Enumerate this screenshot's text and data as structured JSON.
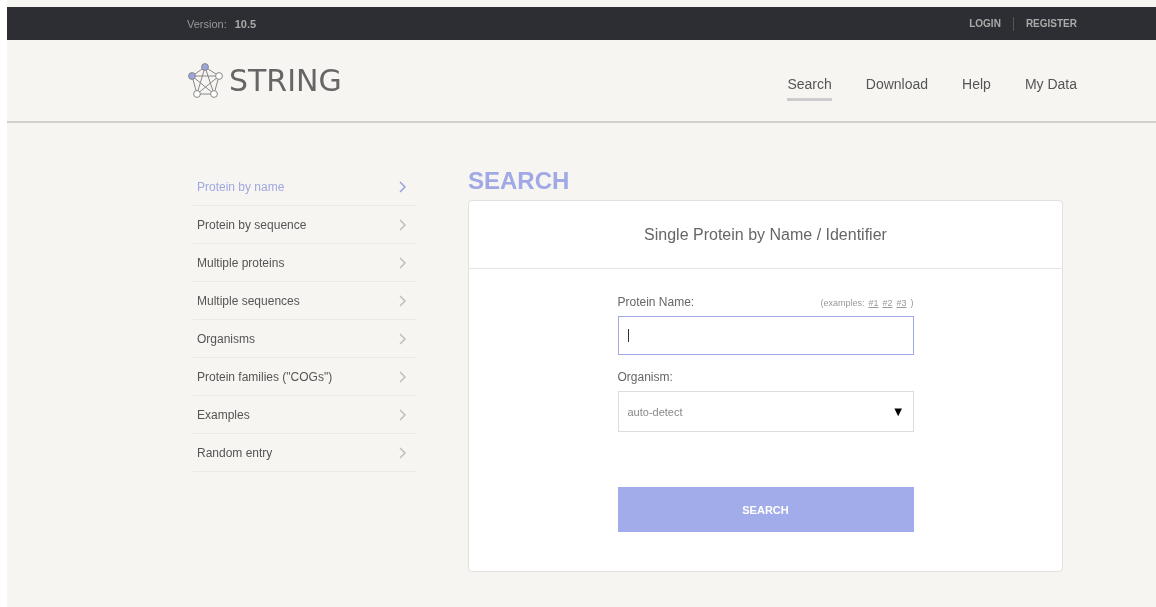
{
  "top_bar": {
    "version_label": "Version:",
    "version": "10.5",
    "links": [
      "LOGIN",
      "REGISTER"
    ]
  },
  "header": {
    "logo_text": "STRING",
    "nav": [
      {
        "label": "Search",
        "selected": true
      },
      {
        "label": "Download",
        "selected": false
      },
      {
        "label": "Help",
        "selected": false
      },
      {
        "label": "My Data",
        "selected": false
      }
    ]
  },
  "sidebar": {
    "items": [
      {
        "label": "Protein by name",
        "selected": true
      },
      {
        "label": "Protein by sequence",
        "selected": false
      },
      {
        "label": "Multiple proteins",
        "selected": false
      },
      {
        "label": "Multiple sequences",
        "selected": false
      },
      {
        "label": "Organisms",
        "selected": false
      },
      {
        "label": "Protein families (\"COGs\")",
        "selected": false
      },
      {
        "label": "Examples",
        "selected": false
      },
      {
        "label": "Random entry",
        "selected": false
      }
    ]
  },
  "main": {
    "heading": "SEARCH",
    "card_title": "Single Protein by Name / Identifier",
    "protein_field": {
      "label": "Protein Name:",
      "examples_prefix": "(examples:",
      "examples": [
        "#1",
        "#2",
        "#3"
      ],
      "examples_suffix": ")",
      "focused": true
    },
    "organism_field": {
      "label": "Organism:",
      "value": "auto-detect",
      "arrow": "▼"
    },
    "button": "SEARCH"
  }
}
